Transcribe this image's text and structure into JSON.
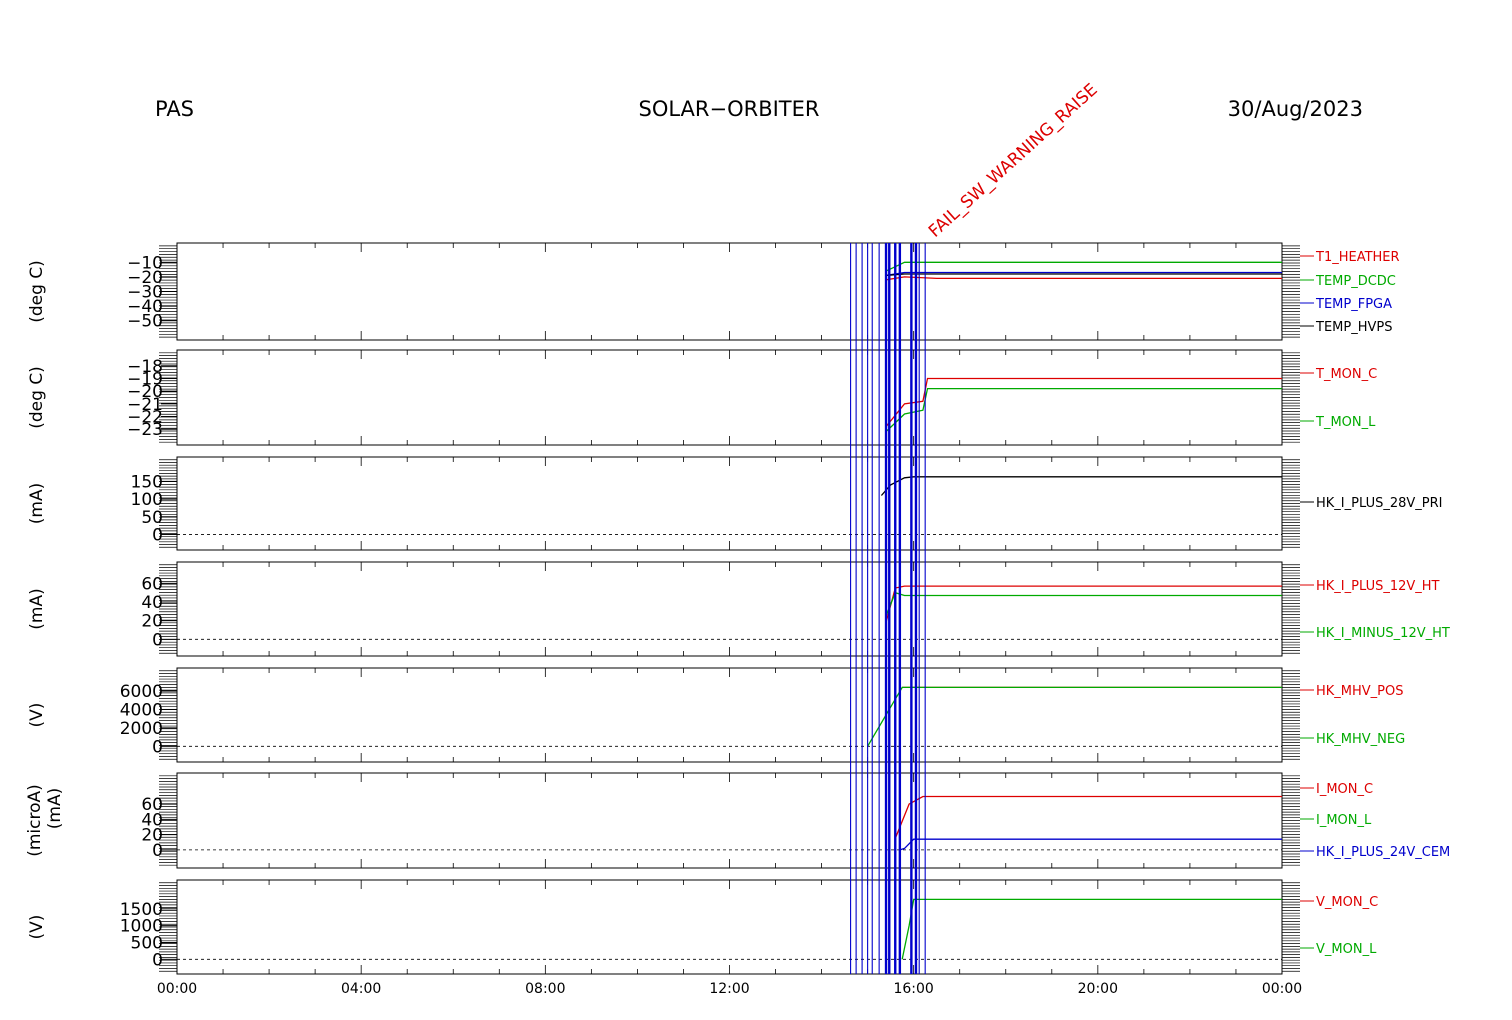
{
  "header": {
    "left": "PAS",
    "center": "SOLAR−ORBITER",
    "right": "30/Aug/2023"
  },
  "annotation_label": "FAIL_SW_WARNING_RAISE",
  "annotation_color": "#dd0000",
  "event_color": "#0000cc",
  "xaxis": {
    "ticks": [
      "00:00",
      "04:00",
      "08:00",
      "12:00",
      "16:00",
      "20:00",
      "00:00"
    ],
    "range_hours": [
      0,
      24
    ]
  },
  "chart_data": [
    {
      "type": "line",
      "ylabel": "(deg C)",
      "ylim": [
        -55,
        -5
      ],
      "yticks": [
        "−10",
        "−20",
        "−30",
        "−40",
        "−50"
      ],
      "ytick_values": [
        -10,
        -20,
        -30,
        -40,
        -50
      ],
      "series": [
        {
          "name": "T1_HEATHER",
          "color": "#dd0000",
          "points": [
            [
              15.4,
              -22
            ],
            [
              15.8,
              -20
            ],
            [
              16.5,
              -21
            ],
            [
              24,
              -21
            ]
          ]
        },
        {
          "name": "TEMP_DCDC",
          "color": "#00aa00",
          "points": [
            [
              15.4,
              -16
            ],
            [
              15.8,
              -10
            ],
            [
              16.5,
              -10
            ],
            [
              24,
              -10
            ]
          ]
        },
        {
          "name": "TEMP_FPGA",
          "color": "#0000cc",
          "points": [
            [
              15.4,
              -19
            ],
            [
              15.8,
              -17
            ],
            [
              16.5,
              -17
            ],
            [
              24,
              -17
            ]
          ]
        },
        {
          "name": "TEMP_HVPS",
          "color": "#000000",
          "points": [
            [
              15.4,
              -19
            ],
            [
              15.8,
              -18
            ],
            [
              16.5,
              -18
            ],
            [
              24,
              -18
            ]
          ]
        }
      ]
    },
    {
      "type": "line",
      "ylabel": "(deg C)",
      "ylim": [
        -23.3,
        -17.7
      ],
      "yticks": [
        "−18",
        "−19",
        "−20",
        "−21",
        "−22",
        "−23"
      ],
      "ytick_values": [
        -18,
        -19,
        -20,
        -21,
        -22,
        -23
      ],
      "series": [
        {
          "name": "T_MON_C",
          "color": "#dd0000",
          "points": [
            [
              15.4,
              -22.8
            ],
            [
              15.8,
              -21.0
            ],
            [
              16.2,
              -20.8
            ],
            [
              16.3,
              -19.0
            ],
            [
              24,
              -19.0
            ]
          ]
        },
        {
          "name": "T_MON_L",
          "color": "#00aa00",
          "points": [
            [
              15.4,
              -23.2
            ],
            [
              15.8,
              -21.8
            ],
            [
              16.2,
              -21.5
            ],
            [
              16.3,
              -19.8
            ],
            [
              24,
              -19.8
            ]
          ]
        }
      ]
    },
    {
      "type": "line",
      "ylabel": "(mA)",
      "ylim": [
        -10,
        185
      ],
      "yticks": [
        "150",
        "100",
        "50",
        "0"
      ],
      "ytick_values": [
        150,
        100,
        50,
        0
      ],
      "series": [
        {
          "name": "HK_I_PLUS_28V_PRI",
          "color": "#000000",
          "points": [
            [
              15.3,
              110
            ],
            [
              15.5,
              140
            ],
            [
              15.8,
              160
            ],
            [
              16.0,
              163
            ],
            [
              24,
              163
            ]
          ]
        }
      ]
    },
    {
      "type": "line",
      "ylabel": "(mA)",
      "ylim": [
        -5,
        70
      ],
      "yticks": [
        "60",
        "40",
        "20",
        "0"
      ],
      "ytick_values": [
        60,
        40,
        20,
        0
      ],
      "series": [
        {
          "name": "HK_I_PLUS_12V_HT",
          "color": "#dd0000",
          "points": [
            [
              15.4,
              18
            ],
            [
              15.6,
              55
            ],
            [
              15.8,
              57
            ],
            [
              24,
              57
            ]
          ]
        },
        {
          "name": "HK_I_MINUS_12V_HT",
          "color": "#00aa00",
          "points": [
            [
              15.4,
              25
            ],
            [
              15.6,
              50
            ],
            [
              15.8,
              47
            ],
            [
              24,
              47
            ]
          ]
        }
      ]
    },
    {
      "type": "line",
      "ylabel": "(V)",
      "ylim": [
        -400,
        7200
      ],
      "yticks": [
        "6000",
        "4000",
        "2000",
        "0"
      ],
      "ytick_values": [
        6000,
        4000,
        2000,
        0
      ],
      "series": [
        {
          "name": "HK_MHV_POS",
          "color": "#dd0000",
          "points": [
            [
              15.75,
              6400
            ],
            [
              24,
              6400
            ]
          ]
        },
        {
          "name": "HK_MHV_NEG",
          "color": "#00aa00",
          "points": [
            [
              15.0,
              0
            ],
            [
              15.75,
              6400
            ],
            [
              24,
              6400
            ]
          ]
        }
      ]
    },
    {
      "type": "line",
      "ylabel": "(microA)",
      "ylabel2": "(mA)",
      "ylim": [
        -8,
        85
      ],
      "yticks": [
        "60",
        "40",
        "20",
        "0"
      ],
      "ytick_values": [
        60,
        40,
        20,
        0
      ],
      "series": [
        {
          "name": "I_MON_C",
          "color": "#dd0000",
          "points": [
            [
              15.6,
              15
            ],
            [
              15.9,
              60
            ],
            [
              16.2,
              70
            ],
            [
              24,
              70
            ]
          ]
        },
        {
          "name": "I_MON_L",
          "color": "#00aa00",
          "points": []
        },
        {
          "name": "HK_I_PLUS_24V_CEM",
          "color": "#0000cc",
          "points": [
            [
              15.7,
              0
            ],
            [
              15.8,
              2
            ],
            [
              16.0,
              14
            ],
            [
              24,
              14
            ]
          ]
        }
      ]
    },
    {
      "type": "line",
      "ylabel": "(V)",
      "ylim": [
        -80,
        2000
      ],
      "yticks": [
        "1500",
        "1000",
        "500",
        "0"
      ],
      "ytick_values": [
        1500,
        1000,
        500,
        0
      ],
      "series": [
        {
          "name": "V_MON_C",
          "color": "#dd0000",
          "points": []
        },
        {
          "name": "V_MON_L",
          "color": "#00aa00",
          "points": [
            [
              15.75,
              0
            ],
            [
              15.9,
              1000
            ],
            [
              16.0,
              1780
            ],
            [
              24,
              1780
            ]
          ]
        }
      ]
    }
  ],
  "event_times_hours": [
    14.63,
    14.75,
    14.88,
    15.0,
    15.1,
    15.25,
    15.4,
    15.47,
    15.6,
    15.7,
    15.95,
    16.05,
    16.12,
    16.25
  ]
}
